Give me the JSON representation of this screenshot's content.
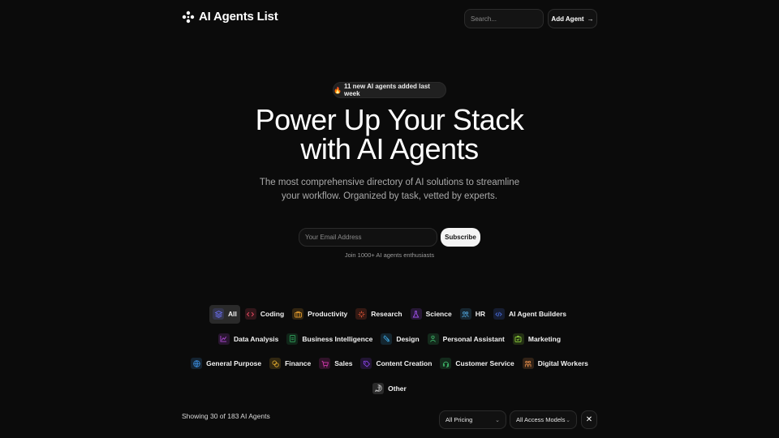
{
  "header": {
    "brand": "AI Agents List",
    "search_placeholder": "Search...",
    "add_agent_label": "Add Agent",
    "add_agent_arrow": "→"
  },
  "hero": {
    "badge_emoji": "🔥",
    "badge_text": "11 new AI agents added last week",
    "title_line1": "Power Up Your Stack",
    "title_line2": "with AI Agents",
    "subtitle": "The most comprehensive directory of AI solutions to streamline your workflow. Organized by task, vetted by experts."
  },
  "newsletter": {
    "email_placeholder": "Your Email Address",
    "subscribe_label": "Subscribe",
    "note": "Join 1000+ AI agents enthusiasts"
  },
  "categories": [
    {
      "label": "All",
      "icon": "layers-icon",
      "color": "#6b6ff0",
      "active": true
    },
    {
      "label": "Coding",
      "icon": "code-icon",
      "color": "#e0485f",
      "active": false
    },
    {
      "label": "Productivity",
      "icon": "briefcase-icon",
      "color": "#e39a2d",
      "active": false
    },
    {
      "label": "Research",
      "icon": "sparkle-icon",
      "color": "#ef5a3a",
      "active": false
    },
    {
      "label": "Science",
      "icon": "flask-icon",
      "color": "#a855f7",
      "active": false
    },
    {
      "label": "HR",
      "icon": "users-icon",
      "color": "#4fa3d9",
      "active": false
    },
    {
      "label": "AI Agent Builders",
      "icon": "code-tag-icon",
      "color": "#4a6ee0",
      "active": false
    },
    {
      "label": "Data Analysis",
      "icon": "chart-icon",
      "color": "#b04ad8",
      "active": false
    },
    {
      "label": "Business Intelligence",
      "icon": "report-icon",
      "color": "#2f9e5a",
      "active": false
    },
    {
      "label": "Design",
      "icon": "pen-tool-icon",
      "color": "#3ba0d9",
      "active": false
    },
    {
      "label": "Personal Assistant",
      "icon": "user-icon",
      "color": "#3fb86b",
      "active": false
    },
    {
      "label": "Marketing",
      "icon": "shopping-bag-icon",
      "color": "#8ed13b",
      "active": false
    },
    {
      "label": "General Purpose",
      "icon": "globe-icon",
      "color": "#3b8ee0",
      "active": false
    },
    {
      "label": "Finance",
      "icon": "coins-icon",
      "color": "#e0a92d",
      "active": false
    },
    {
      "label": "Sales",
      "icon": "cart-icon",
      "color": "#d63ab0",
      "active": false
    },
    {
      "label": "Content Creation",
      "icon": "tag-icon",
      "color": "#8b45e8",
      "active": false
    },
    {
      "label": "Customer Service",
      "icon": "headset-icon",
      "color": "#3fb86b",
      "active": false
    },
    {
      "label": "Digital Workers",
      "icon": "workers-icon",
      "color": "#e08a4a",
      "active": false
    },
    {
      "label": "Other",
      "icon": "message-question-icon",
      "color": "#bdbdbd",
      "active": false
    }
  ],
  "listing": {
    "showing_text": "Showing 30 of 183 AI Agents",
    "pricing_filter": "All Pricing",
    "access_filter": "All Access Models",
    "clear_label": "✕"
  }
}
